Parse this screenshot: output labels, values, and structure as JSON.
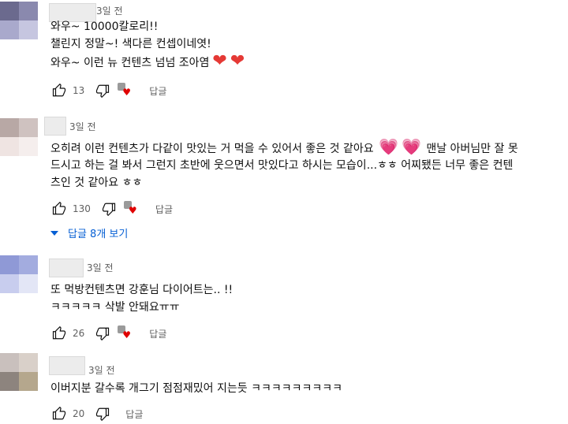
{
  "comments": [
    {
      "time": "3일 전",
      "lines": [
        "와우~ 10000칼로리!!",
        "챌린지 정말~! 색다른  컨셉이네엿!",
        "와우~ 이런 뉴 컨텐츠 넘넘 조아염"
      ],
      "likes": "13",
      "reply_label": "답글",
      "avatar_colors": [
        "#6b6a8e",
        "#8a89ae",
        "#a9a9cc",
        "#c6c6e0"
      ]
    },
    {
      "time": "3일 전",
      "lines": [
        "오히려 이런 컨텐츠가 다같이 맛있는 거 먹을 수 있어서 좋은 것 같아요",
        "드시고 하는 걸 봐서 그런지 초반에 웃으면서 맛있다고 하시는 모습이...ㅎㅎ 어찌됐든 너무 좋은 컨텐",
        "츠인 것 같아요 ㅎㅎ"
      ],
      "line1_tail": "맨날 아버님만 잘 못",
      "likes": "130",
      "reply_label": "답글",
      "replies_toggle": "답글 8개 보기",
      "avatar_colors": [
        "#b8a8a5",
        "#cfc2c0",
        "#efe4e2",
        "#f5eeed"
      ]
    },
    {
      "time": "3일 전",
      "lines": [
        "또 먹방컨텐츠면 강훈님 다이어트는.. !!",
        "ㅋㅋㅋㅋㅋ 삭발 안돼요ㅠㅠ"
      ],
      "likes": "26",
      "reply_label": "답글",
      "avatar_colors": [
        "#8f99d6",
        "#a3acdf",
        "#c8cdee",
        "#e3e6f6"
      ]
    },
    {
      "time": "3일 전",
      "lines": [
        "이버지분 갈수록 개그기 점점재밌어 지는듯 ㅋㅋㅋㅋㅋㅋㅋㅋㅋ"
      ],
      "likes": "20",
      "reply_label": "답글",
      "avatar_colors": [
        "#c9c0bd",
        "#d9d0c9",
        "#8d847e",
        "#b5a78d"
      ]
    }
  ],
  "icons": {
    "like": "thumbs-up-icon",
    "dislike": "thumbs-down-icon",
    "creator_heart": "creator-heart-icon",
    "heart_red": "red-heart-emoji",
    "heart_pink": "pink-heart-emoji",
    "expand": "triangle-down-icon"
  },
  "colors": {
    "link_blue": "#065fd4",
    "meta_gray": "#606060",
    "heart_red": "#e53935"
  }
}
